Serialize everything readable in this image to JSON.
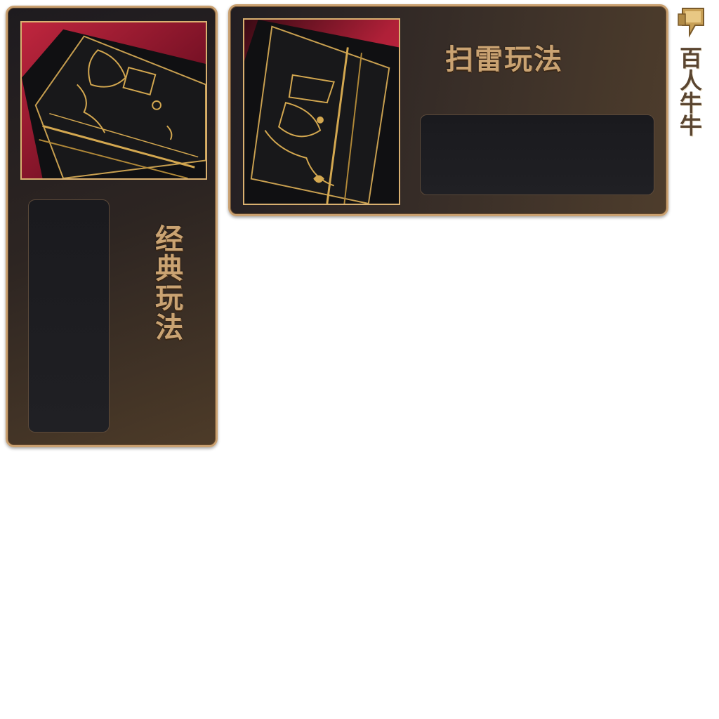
{
  "panels": {
    "classic": {
      "title": "经典玩法"
    },
    "mine": {
      "title": "扫雷玩法"
    }
  },
  "side_tab": {
    "label": "百人牛牛",
    "icon": "gold-flag-icon"
  },
  "colors": {
    "gold": "#caa372",
    "frame": "#c9a070",
    "art_red": "#8e1830",
    "slot_bg": "#1a1a1e"
  }
}
